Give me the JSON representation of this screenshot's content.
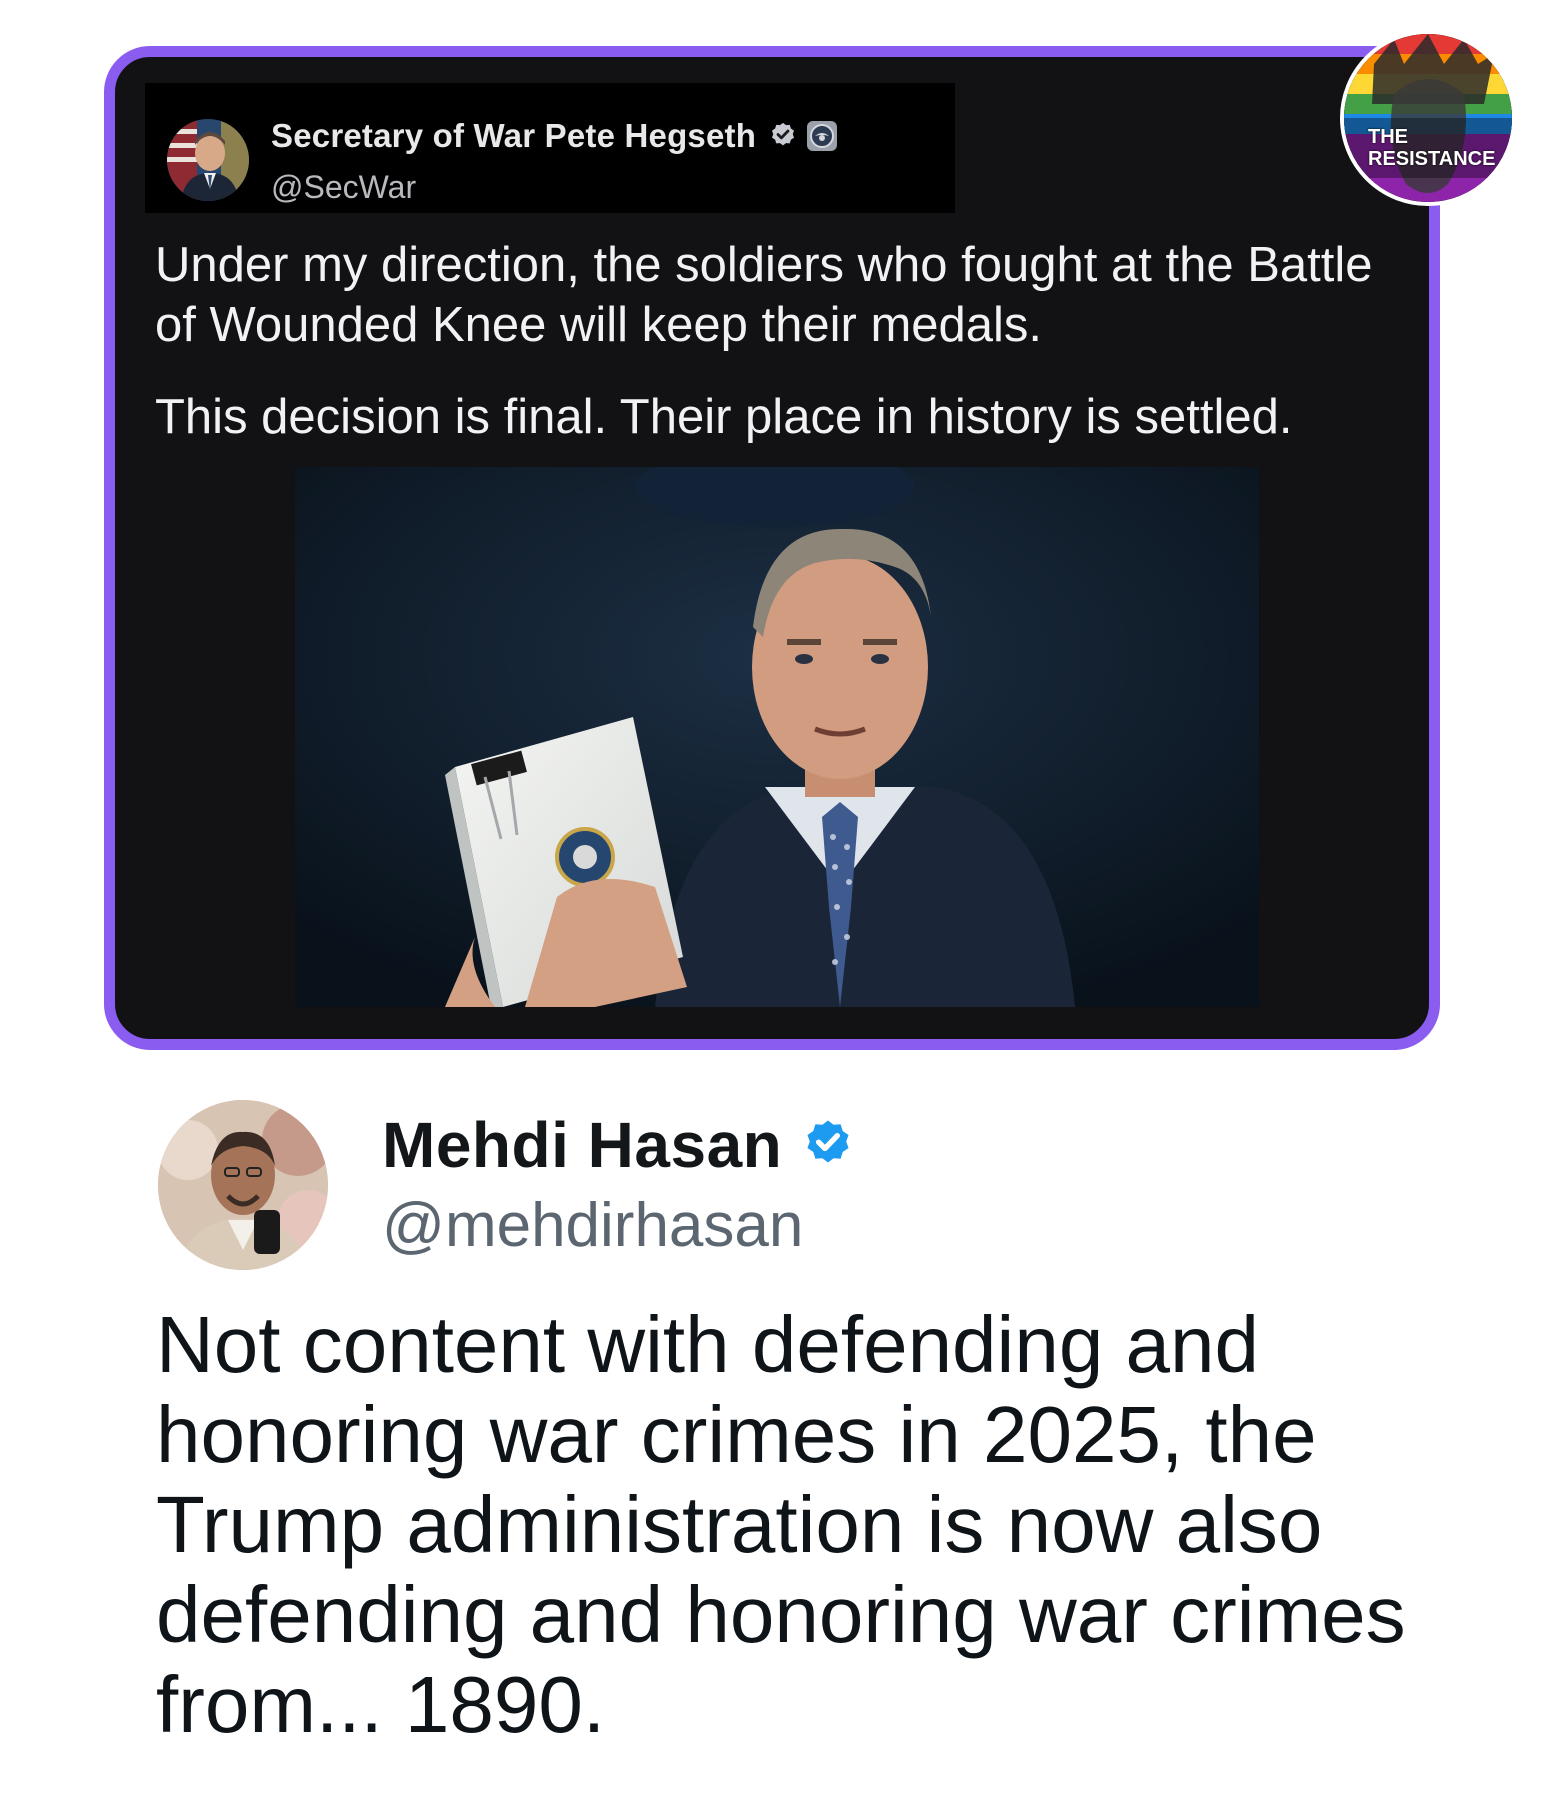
{
  "quoted_post": {
    "author_name": "Secretary of War Pete Hegseth",
    "author_handle": "@SecWar",
    "paragraph_1": "Under my direction, the soldiers who fought at the Battle of Wounded Knee will keep their medals.",
    "paragraph_2": "This decision is final. Their place in history is settled."
  },
  "badge": {
    "line_1": "THE",
    "line_2": "RESISTANCE"
  },
  "reply_post": {
    "author_name": "Mehdi Hasan",
    "author_handle": "@mehdirhasan",
    "text": "Not content with defending and honoring war crimes in 2025, the Trump administration is now also defending and honoring war crimes from... 1890."
  },
  "colors": {
    "card_border": "#8b5cf0",
    "card_background": "#121214",
    "verified_blue": "#1d9bf0",
    "verified_gray": "#c8ccd2"
  },
  "icons": {
    "verified": "verified-badge-icon",
    "seal": "government-seal-icon"
  }
}
